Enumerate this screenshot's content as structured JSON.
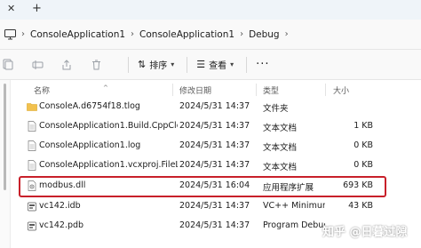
{
  "tabbar": {
    "close_glyph": "✕",
    "add_glyph": "+"
  },
  "address": {
    "icon": "monitor-icon",
    "separator": "›",
    "crumbs": [
      "ConsoleApplication1",
      "ConsoleApplication1",
      "Debug"
    ]
  },
  "toolbar": {
    "icons": [
      "copy-icon",
      "rename-icon",
      "share-icon",
      "delete-icon"
    ],
    "sort_label": "排序",
    "view_label": "查看",
    "more_glyph": "···"
  },
  "columns": {
    "name": "名称",
    "date": "修改日期",
    "type": "类型",
    "size": "大小"
  },
  "files": [
    {
      "name": "ConsoleA.d6754f18.tlog",
      "date": "2024/5/31 14:37",
      "type": "文件夹",
      "size": "",
      "icon": "folder-icon"
    },
    {
      "name": "ConsoleApplication1.Build.CppClean...",
      "date": "2024/5/31 14:37",
      "type": "文本文档",
      "size": "1 KB",
      "icon": "document-icon"
    },
    {
      "name": "ConsoleApplication1.log",
      "date": "2024/5/31 14:37",
      "type": "文本文档",
      "size": "0 KB",
      "icon": "document-icon"
    },
    {
      "name": "ConsoleApplication1.vcxproj.FileList...",
      "date": "2024/5/31 14:37",
      "type": "文本文档",
      "size": "0 KB",
      "icon": "document-icon"
    },
    {
      "name": "modbus.dll",
      "date": "2024/5/31 16:04",
      "type": "应用程序扩展",
      "size": "693 KB",
      "icon": "dll-icon"
    },
    {
      "name": "vc142.idb",
      "date": "2024/5/31 14:37",
      "type": "VC++ Minimum ...",
      "size": "43 KB",
      "icon": "idb-file-icon"
    },
    {
      "name": "vc142.pdb",
      "date": "2024/5/31 14:37",
      "type": "Program Debug ...",
      "size": "",
      "icon": "pdb-file-icon"
    }
  ],
  "watermark": "知乎 @日暮过隙",
  "colors": {
    "highlight": "#c8202a",
    "folder": "#f2c14e"
  }
}
